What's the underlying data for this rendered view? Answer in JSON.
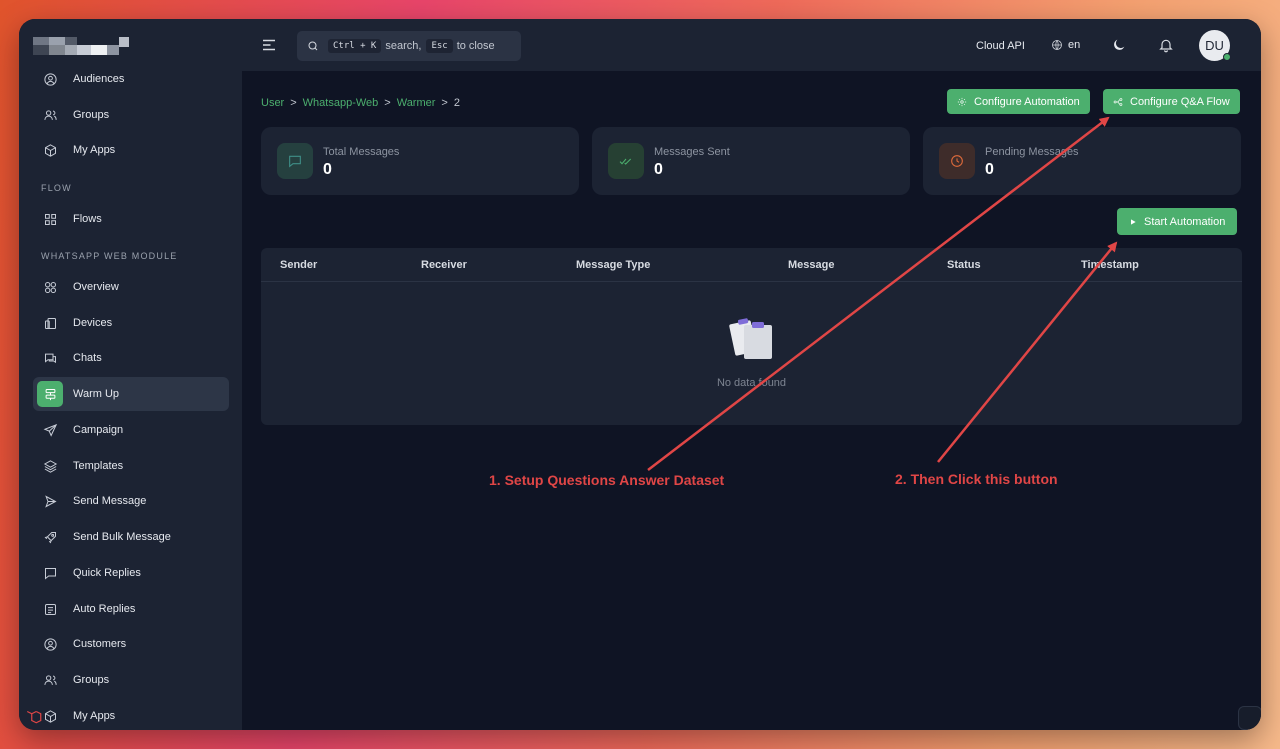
{
  "sidebar": {
    "items_top": [
      {
        "label": "Audiences",
        "icon": "user-circle-icon"
      },
      {
        "label": "Groups",
        "icon": "users-icon"
      },
      {
        "label": "My Apps",
        "icon": "cube-icon"
      }
    ],
    "section_flow": "FLOW",
    "flow_items": [
      {
        "label": "Flows",
        "icon": "grid-icon"
      }
    ],
    "section_whatsapp": "WHATSAPP WEB MODULE",
    "whatsapp_items": [
      {
        "label": "Overview",
        "icon": "circles-icon"
      },
      {
        "label": "Devices",
        "icon": "devices-icon"
      },
      {
        "label": "Chats",
        "icon": "chat-icon"
      },
      {
        "label": "Warm Up",
        "icon": "warmup-icon",
        "active": true
      },
      {
        "label": "Campaign",
        "icon": "send-icon"
      },
      {
        "label": "Templates",
        "icon": "layers-icon"
      },
      {
        "label": "Send Message",
        "icon": "play-send-icon"
      },
      {
        "label": "Send Bulk Message",
        "icon": "rocket-icon"
      },
      {
        "label": "Quick Replies",
        "icon": "quick-reply-icon"
      },
      {
        "label": "Auto Replies",
        "icon": "auto-reply-icon"
      },
      {
        "label": "Customers",
        "icon": "user-circle-icon"
      },
      {
        "label": "Groups",
        "icon": "users-icon"
      },
      {
        "label": "My Apps",
        "icon": "cube-icon"
      }
    ]
  },
  "header": {
    "search_kbd_1": "Ctrl + K",
    "search_text_1": "search,",
    "search_kbd_2": "Esc",
    "search_text_2": "to close",
    "cloud_api": "Cloud API",
    "language": "en",
    "avatar_initials": "DU"
  },
  "breadcrumb": {
    "items": [
      "User",
      "Whatsapp-Web",
      "Warmer"
    ],
    "separator": ">",
    "current": "2"
  },
  "buttons": {
    "configure_automation": "Configure Automation",
    "configure_qa_flow": "Configure Q&A Flow",
    "start_automation": "Start Automation"
  },
  "stats": [
    {
      "label": "Total Messages",
      "value": "0",
      "color": "#3f8f88"
    },
    {
      "label": "Messages Sent",
      "value": "0",
      "color": "#4caf6e"
    },
    {
      "label": "Pending Messages",
      "value": "0",
      "color": "#e06b3b"
    }
  ],
  "table": {
    "columns": [
      "Sender",
      "Receiver",
      "Message Type",
      "Message",
      "Status",
      "Timestamp"
    ],
    "empty_text": "No data found"
  },
  "annotations": {
    "step1": "1. Setup Questions Answer Dataset",
    "step2": "2. Then Click this button",
    "color": "#e04646"
  },
  "colors": {
    "accent": "#4caf6e",
    "sidebar_bg": "#1c2333",
    "main_bg": "#0f1424"
  }
}
